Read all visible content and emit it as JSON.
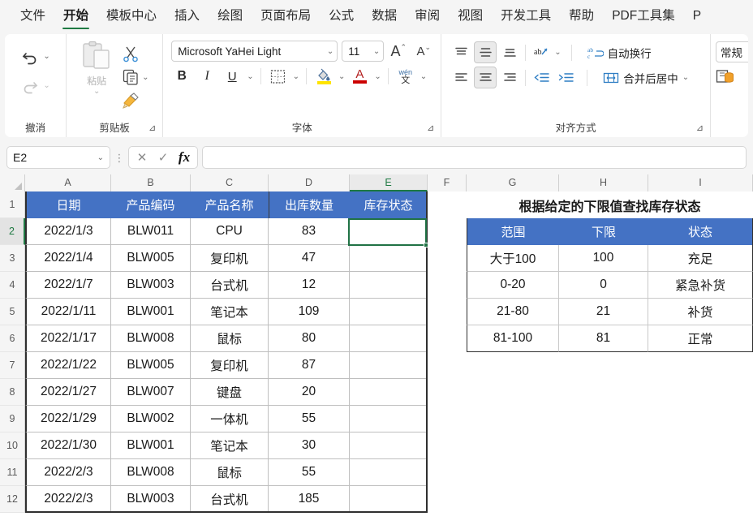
{
  "menu": {
    "items": [
      {
        "label": "文件",
        "active": false
      },
      {
        "label": "开始",
        "active": true
      },
      {
        "label": "模板中心",
        "active": false
      },
      {
        "label": "插入",
        "active": false
      },
      {
        "label": "绘图",
        "active": false
      },
      {
        "label": "页面布局",
        "active": false
      },
      {
        "label": "公式",
        "active": false
      },
      {
        "label": "数据",
        "active": false
      },
      {
        "label": "审阅",
        "active": false
      },
      {
        "label": "视图",
        "active": false
      },
      {
        "label": "开发工具",
        "active": false
      },
      {
        "label": "帮助",
        "active": false
      },
      {
        "label": "PDF工具集",
        "active": false
      },
      {
        "label": "P",
        "active": false
      }
    ]
  },
  "ribbon": {
    "groups": {
      "undo": {
        "label": "撤消",
        "undo_icon": "undo-arrow-icon",
        "redo_icon": "redo-arrow-icon"
      },
      "clipboard": {
        "label": "剪贴板",
        "paste_label": "粘贴",
        "cut_icon": "scissors-icon",
        "copy_icon": "copy-icon",
        "format_painter_icon": "format-painter-icon",
        "launcher": "⊿"
      },
      "font": {
        "label": "字体",
        "font_name": "Microsoft YaHei Light",
        "font_size": "11",
        "grow_font": "A",
        "shrink_font": "A",
        "bold": "B",
        "italic": "I",
        "underline": "U",
        "border_icon": "borders-icon",
        "fill_color_icon": "fill-color-icon",
        "fill_color": "#ffe400",
        "font_color_icon": "font-color-icon",
        "font_color": "#cc0000",
        "phonetic_top": "wén",
        "phonetic_bottom": "文",
        "launcher": "⊿"
      },
      "alignment": {
        "label": "对齐方式",
        "wrap_text": "自动换行",
        "merge_center": "合并后居中",
        "orientation_icon": "text-orientation-icon",
        "decrease_indent_icon": "decrease-indent-icon",
        "increase_indent_icon": "increase-indent-icon",
        "launcher": "⊿"
      },
      "number": {
        "format": "常规",
        "accounting_icon": "accounting-format-icon"
      }
    }
  },
  "formula_bar": {
    "name_box": "E2",
    "cancel_icon": "cancel-x-icon",
    "accept_icon": "accept-check-icon",
    "fx_icon": "fx",
    "formula_value": "",
    "formula_placeholder": ""
  },
  "grid": {
    "columns": [
      {
        "label": "A",
        "width": 106,
        "selected": false
      },
      {
        "label": "B",
        "width": 98,
        "selected": false
      },
      {
        "label": "C",
        "width": 96,
        "selected": false
      },
      {
        "label": "D",
        "width": 100,
        "selected": false
      },
      {
        "label": "E",
        "width": 96,
        "selected": true
      },
      {
        "label": "F",
        "width": 48,
        "selected": false
      },
      {
        "label": "G",
        "width": 114,
        "selected": false
      },
      {
        "label": "H",
        "width": 110,
        "selected": false
      },
      {
        "label": "I",
        "width": 129,
        "selected": false
      }
    ],
    "rows": [
      {
        "label": "1",
        "selected": false
      },
      {
        "label": "2",
        "selected": true
      },
      {
        "label": "3",
        "selected": false
      },
      {
        "label": "4",
        "selected": false
      },
      {
        "label": "5",
        "selected": false
      },
      {
        "label": "6",
        "selected": false
      },
      {
        "label": "7",
        "selected": false
      },
      {
        "label": "8",
        "selected": false
      },
      {
        "label": "9",
        "selected": false
      },
      {
        "label": "10",
        "selected": false
      },
      {
        "label": "11",
        "selected": false
      },
      {
        "label": "12",
        "selected": false
      }
    ],
    "selected_cell": "E2",
    "selection_color": "#207245",
    "header_fill": "#4472c4"
  },
  "main_table": {
    "headers": [
      "日期",
      "产品编码",
      "产品名称",
      "出库数量",
      "库存状态"
    ],
    "rows": [
      [
        "2022/1/3",
        "BLW011",
        "CPU",
        "83",
        ""
      ],
      [
        "2022/1/4",
        "BLW005",
        "复印机",
        "47",
        ""
      ],
      [
        "2022/1/7",
        "BLW003",
        "台式机",
        "12",
        ""
      ],
      [
        "2022/1/11",
        "BLW001",
        "笔记本",
        "109",
        ""
      ],
      [
        "2022/1/17",
        "BLW008",
        "鼠标",
        "80",
        ""
      ],
      [
        "2022/1/22",
        "BLW005",
        "复印机",
        "87",
        ""
      ],
      [
        "2022/1/27",
        "BLW007",
        "键盘",
        "20",
        ""
      ],
      [
        "2022/1/29",
        "BLW002",
        "一体机",
        "55",
        ""
      ],
      [
        "2022/1/30",
        "BLW001",
        "笔记本",
        "30",
        ""
      ],
      [
        "2022/2/3",
        "BLW008",
        "鼠标",
        "55",
        ""
      ],
      [
        "2022/2/3",
        "BLW003",
        "台式机",
        "185",
        ""
      ]
    ]
  },
  "lookup_table": {
    "title": "根据给定的下限值查找库存状态",
    "headers": [
      "范围",
      "下限",
      "状态"
    ],
    "rows": [
      [
        "大于100",
        "100",
        "充足"
      ],
      [
        "0-20",
        "0",
        "紧急补货"
      ],
      [
        "21-80",
        "21",
        "补货"
      ],
      [
        "81-100",
        "81",
        "正常"
      ]
    ]
  }
}
